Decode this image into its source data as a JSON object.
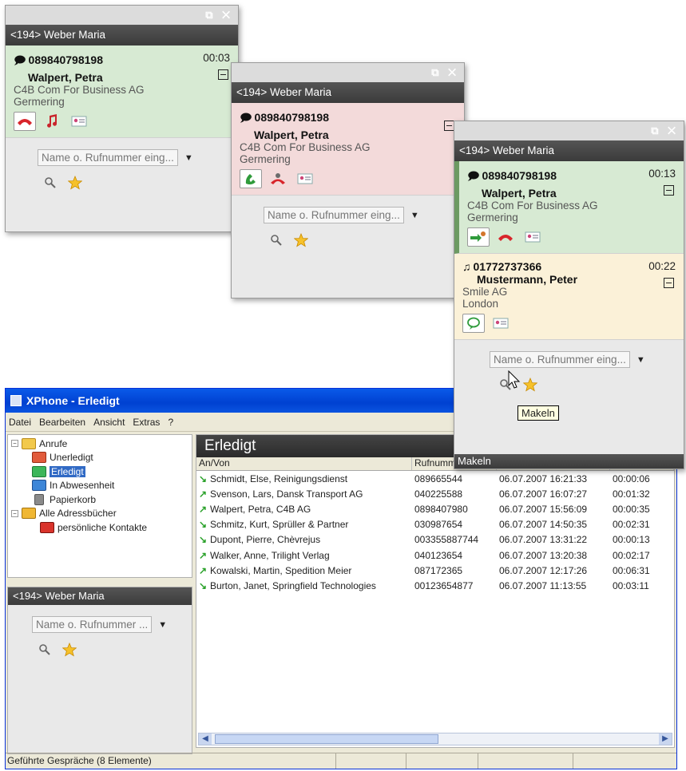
{
  "extension_name": "<194> Weber Maria",
  "window_controls": "⧉ ✕",
  "search": {
    "placeholder": "Name o. Rufnummer eing...",
    "placeholder_short": "Name o. Rufnummer ..."
  },
  "popup1": {
    "call": {
      "number": "089840798198",
      "time": "00:03",
      "name": "Walpert, Petra",
      "company": "C4B Com For Business AG",
      "city": "Germering"
    }
  },
  "popup2": {
    "call": {
      "number": "089840798198",
      "name": "Walpert, Petra",
      "company": "C4B Com For Business AG",
      "city": "Germering"
    }
  },
  "popup3": {
    "call1": {
      "number": "089840798198",
      "time": "00:13",
      "name": "Walpert, Petra",
      "company": "C4B Com For Business AG",
      "city": "Germering"
    },
    "call2": {
      "number": "01772737366",
      "time": "00:22",
      "name": "Mustermann, Peter",
      "company": "Smile AG",
      "city": "London"
    },
    "tooltip": "Makeln",
    "status": "Makeln"
  },
  "main": {
    "title": "XPhone - Erledigt",
    "menu": [
      "Datei",
      "Bearbeiten",
      "Ansicht",
      "Extras",
      "?"
    ],
    "tree": [
      {
        "label": "Anrufe",
        "level": 0,
        "expander": "−"
      },
      {
        "label": "Unerledigt",
        "level": 1
      },
      {
        "label": "Erledigt",
        "level": 1,
        "selected": true
      },
      {
        "label": "In Abwesenheit",
        "level": 1
      },
      {
        "label": "Papierkorb",
        "level": 1
      },
      {
        "label": "Alle Adressbücher",
        "level": 0,
        "expander": "−"
      },
      {
        "label": "persönliche Kontakte",
        "level": 1
      }
    ],
    "list_header": "Erledigt",
    "columns": [
      "An/Von",
      "Rufnummer",
      "",
      ""
    ],
    "rows": [
      {
        "dir": "in",
        "contact": "Schmidt, Else, Reinigungsdienst",
        "number": "089665544",
        "date": "06.07.2007 16:21:33",
        "duration": "00:00:06"
      },
      {
        "dir": "out",
        "contact": "Svenson, Lars, Dansk Transport AG",
        "number": "040225588",
        "date": "06.07.2007 16:07:27",
        "duration": "00:01:32"
      },
      {
        "dir": "out",
        "contact": "Walpert, Petra, C4B AG",
        "number": "0898407980",
        "date": "06.07.2007 15:56:09",
        "duration": "00:00:35"
      },
      {
        "dir": "in",
        "contact": "Schmitz, Kurt, Sprüller & Partner",
        "number": "030987654",
        "date": "06.07.2007 14:50:35",
        "duration": "00:02:31"
      },
      {
        "dir": "in",
        "contact": "Dupont, Pierre, Chèvrejus",
        "number": "003355887744",
        "date": "06.07.2007 13:31:22",
        "duration": "00:00:13"
      },
      {
        "dir": "out",
        "contact": "Walker, Anne, Trilight Verlag",
        "number": "040123654",
        "date": "06.07.2007 13:20:38",
        "duration": "00:02:17"
      },
      {
        "dir": "out",
        "contact": "Kowalski, Martin, Spedition Meier",
        "number": "087172365",
        "date": "06.07.2007 12:17:26",
        "duration": "00:06:31"
      },
      {
        "dir": "in",
        "contact": "Burton, Janet, Springfield Technologies",
        "number": "00123654877",
        "date": "06.07.2007 11:13:55",
        "duration": "00:03:11"
      }
    ],
    "status_text": "Geführte Gespräche (8 Elemente)"
  },
  "colors": {
    "active_call": "#d7ead3",
    "ringing_call": "#f3dada",
    "held_call": "#fbf1d8",
    "accent": "#316ac5"
  }
}
